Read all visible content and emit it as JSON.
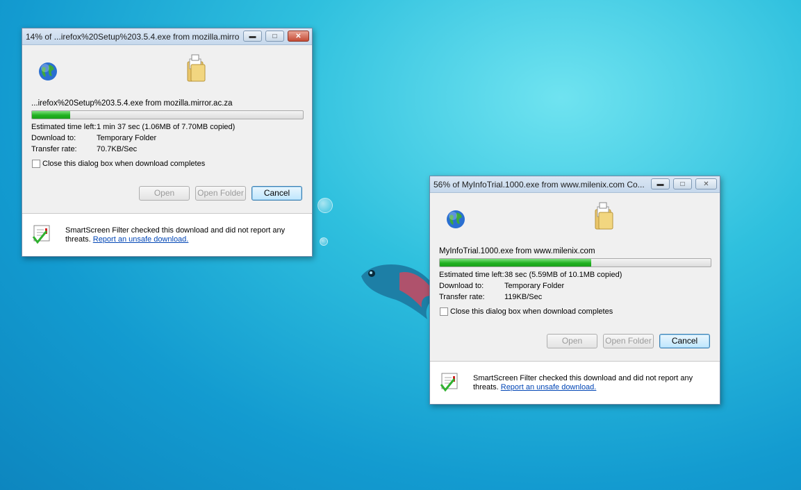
{
  "dialogs": [
    {
      "title": "14% of ...irefox%20Setup%203.5.4.exe from mozilla.mirro...",
      "file": "...irefox%20Setup%203.5.4.exe from mozilla.mirror.ac.za",
      "progress": 0.14,
      "est_label": "Estimated time left:",
      "est_value": "1 min 37 sec (1.06MB of 7.70MB copied)",
      "dl_label": "Download to:",
      "dl_value": "Temporary Folder",
      "tr_label": "Transfer rate:",
      "tr_value": "70.7KB/Sec",
      "checkbox_label": "Close this dialog box when download completes",
      "open_label": "Open",
      "open_folder_label": "Open Folder",
      "cancel_label": "Cancel",
      "smartscreen_text": "SmartScreen Filter checked this download and did not report any",
      "smartscreen_text2": "threats.",
      "smartscreen_link": "Report an unsafe download."
    },
    {
      "title": "56% of MyInfoTrial.1000.exe from www.milenix.com Co...",
      "file": "MyInfoTrial.1000.exe from www.milenix.com",
      "progress": 0.56,
      "est_label": "Estimated time left:",
      "est_value": "38 sec (5.59MB of 10.1MB copied)",
      "dl_label": "Download to:",
      "dl_value": "Temporary Folder",
      "tr_label": "Transfer rate:",
      "tr_value": "119KB/Sec",
      "checkbox_label": "Close this dialog box when download completes",
      "open_label": "Open",
      "open_folder_label": "Open Folder",
      "cancel_label": "Cancel",
      "smartscreen_text": "SmartScreen Filter checked this download and did not report any",
      "smartscreen_text2": "threats.",
      "smartscreen_link": "Report an unsafe download."
    }
  ],
  "icons": {
    "globe": "globe-icon",
    "folder": "folder-icon",
    "shield": "smartscreen-icon",
    "minimize": "minimize-icon",
    "maximize": "maximize-icon",
    "close": "close-icon"
  },
  "colors": {
    "progress_green": "#21b121",
    "link_blue": "#0045b5",
    "close_red": "#c54b35"
  }
}
